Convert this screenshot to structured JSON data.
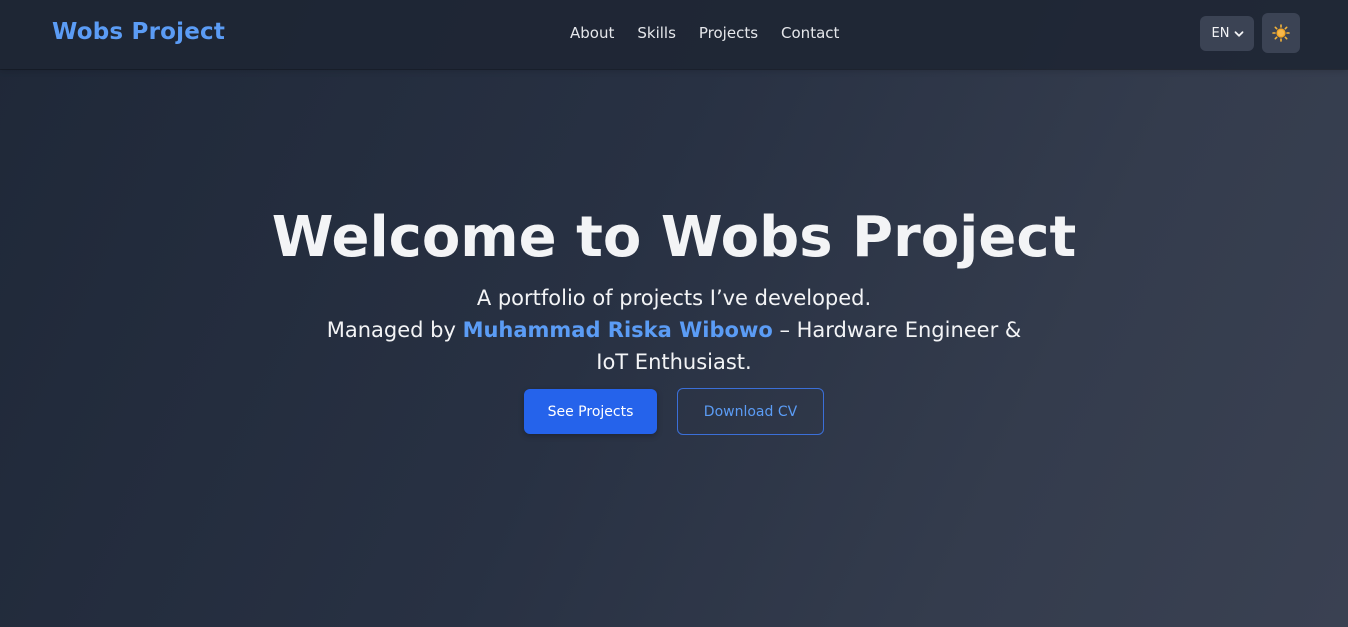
{
  "navbar": {
    "brand": "Wobs Project",
    "links": [
      "About",
      "Skills",
      "Projects",
      "Contact"
    ],
    "language": "EN",
    "language_icon": "chevron-down-icon",
    "theme_icon": "sun-icon"
  },
  "hero": {
    "title": "Welcome to Wobs Project",
    "line1": "A portfolio of projects I’ve developed.",
    "managed_prefix": "Managed by ",
    "owner_name": "Muhammad Riska Wibowo",
    "managed_suffix": " – Hardware Engineer & IoT Enthusiast."
  },
  "buttons": {
    "primary": "See Projects",
    "secondary": "Download CV"
  },
  "colors": {
    "accent": "#5b9cf5",
    "primary_button": "#2563eb",
    "background": "#283143"
  }
}
